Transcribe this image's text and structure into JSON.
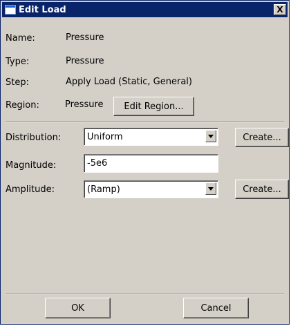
{
  "window": {
    "title": "Edit Load",
    "close_label": "X"
  },
  "info": {
    "name_label": "Name:",
    "name_value": "Pressure",
    "type_label": "Type:",
    "type_value": "Pressure",
    "step_label": "Step:",
    "step_value": "Apply Load (Static, General)",
    "region_label": "Region:",
    "region_value": "Pressure",
    "edit_region_label": "Edit Region..."
  },
  "form": {
    "distribution_label": "Distribution:",
    "distribution_value": "Uniform",
    "distribution_create_label": "Create...",
    "magnitude_label": "Magnitude:",
    "magnitude_value": "-5e6",
    "amplitude_label": "Amplitude:",
    "amplitude_value": "(Ramp)",
    "amplitude_create_label": "Create..."
  },
  "footer": {
    "ok_label": "OK",
    "cancel_label": "Cancel"
  }
}
